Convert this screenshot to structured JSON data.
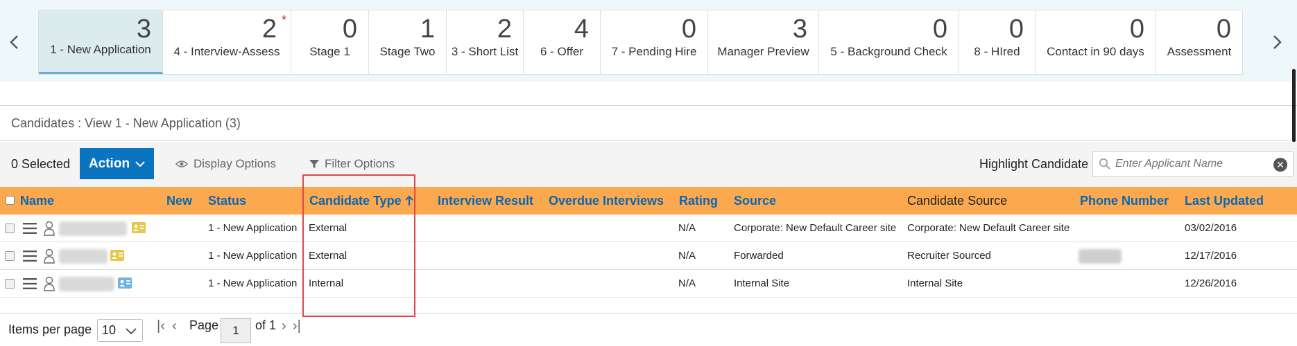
{
  "pipeline": {
    "stages": [
      {
        "count": "3",
        "label": "1 - New Application",
        "active": true
      },
      {
        "count": "2",
        "label": "4 - Interview-Assess",
        "flag": "*"
      },
      {
        "count": "0",
        "label": "Stage 1"
      },
      {
        "count": "1",
        "label": "Stage Two"
      },
      {
        "count": "2",
        "label": "3 - Short List"
      },
      {
        "count": "4",
        "label": "6 - Offer"
      },
      {
        "count": "0",
        "label": "7 - Pending Hire"
      },
      {
        "count": "3",
        "label": "Manager Preview"
      },
      {
        "count": "0",
        "label": "5 - Background Check"
      },
      {
        "count": "0",
        "label": "8 - HIred"
      },
      {
        "count": "0",
        "label": "Contact in 90 days"
      },
      {
        "count": "0",
        "label": "Assessment"
      }
    ]
  },
  "panel": {
    "title": "Candidates : View 1 - New Application (3)"
  },
  "toolbar": {
    "selected": "0 Selected",
    "action_label": "Action",
    "display_options": "Display Options",
    "filter_options": "Filter Options",
    "highlight_label": "Highlight Candidate",
    "search_placeholder": "Enter Applicant Name"
  },
  "table": {
    "columns": {
      "name": "Name",
      "new": "New",
      "status": "Status",
      "candidate_type": "Candidate Type",
      "interview_result": "Interview Result",
      "overdue_interviews": "Overdue Interviews",
      "rating": "Rating",
      "source": "Source",
      "candidate_source": "Candidate Source",
      "phone_number": "Phone Number",
      "last_updated": "Last Updated"
    },
    "rows": [
      {
        "status": "1 - New Application",
        "candidate_type": "External",
        "rating": "N/A",
        "source": "Corporate: New Default Career site",
        "candidate_source": "Corporate: New Default Career site",
        "last_updated": "03/02/2016",
        "card_type": "external"
      },
      {
        "status": "1 - New Application",
        "candidate_type": "External",
        "rating": "N/A",
        "source": "Forwarded",
        "candidate_source": "Recruiter Sourced",
        "last_updated": "12/17/2016",
        "card_type": "external"
      },
      {
        "status": "1 - New Application",
        "candidate_type": "Internal",
        "rating": "N/A",
        "source": "Internal Site",
        "candidate_source": "Internal Site",
        "last_updated": "12/26/2016",
        "card_type": "internal"
      }
    ]
  },
  "pager": {
    "items_label": "Items per page",
    "per_page": "10",
    "page_word": "Page",
    "page_value": "1",
    "of_total": "of 1"
  },
  "colors": {
    "header_bg": "#fba84e",
    "header_text": "#0b66b2",
    "action_button": "#0a74c1",
    "active_stage": "#dcebee",
    "highlight_border": "#e04848",
    "external_card": "#e5c84a",
    "internal_card": "#6fb4e0"
  }
}
